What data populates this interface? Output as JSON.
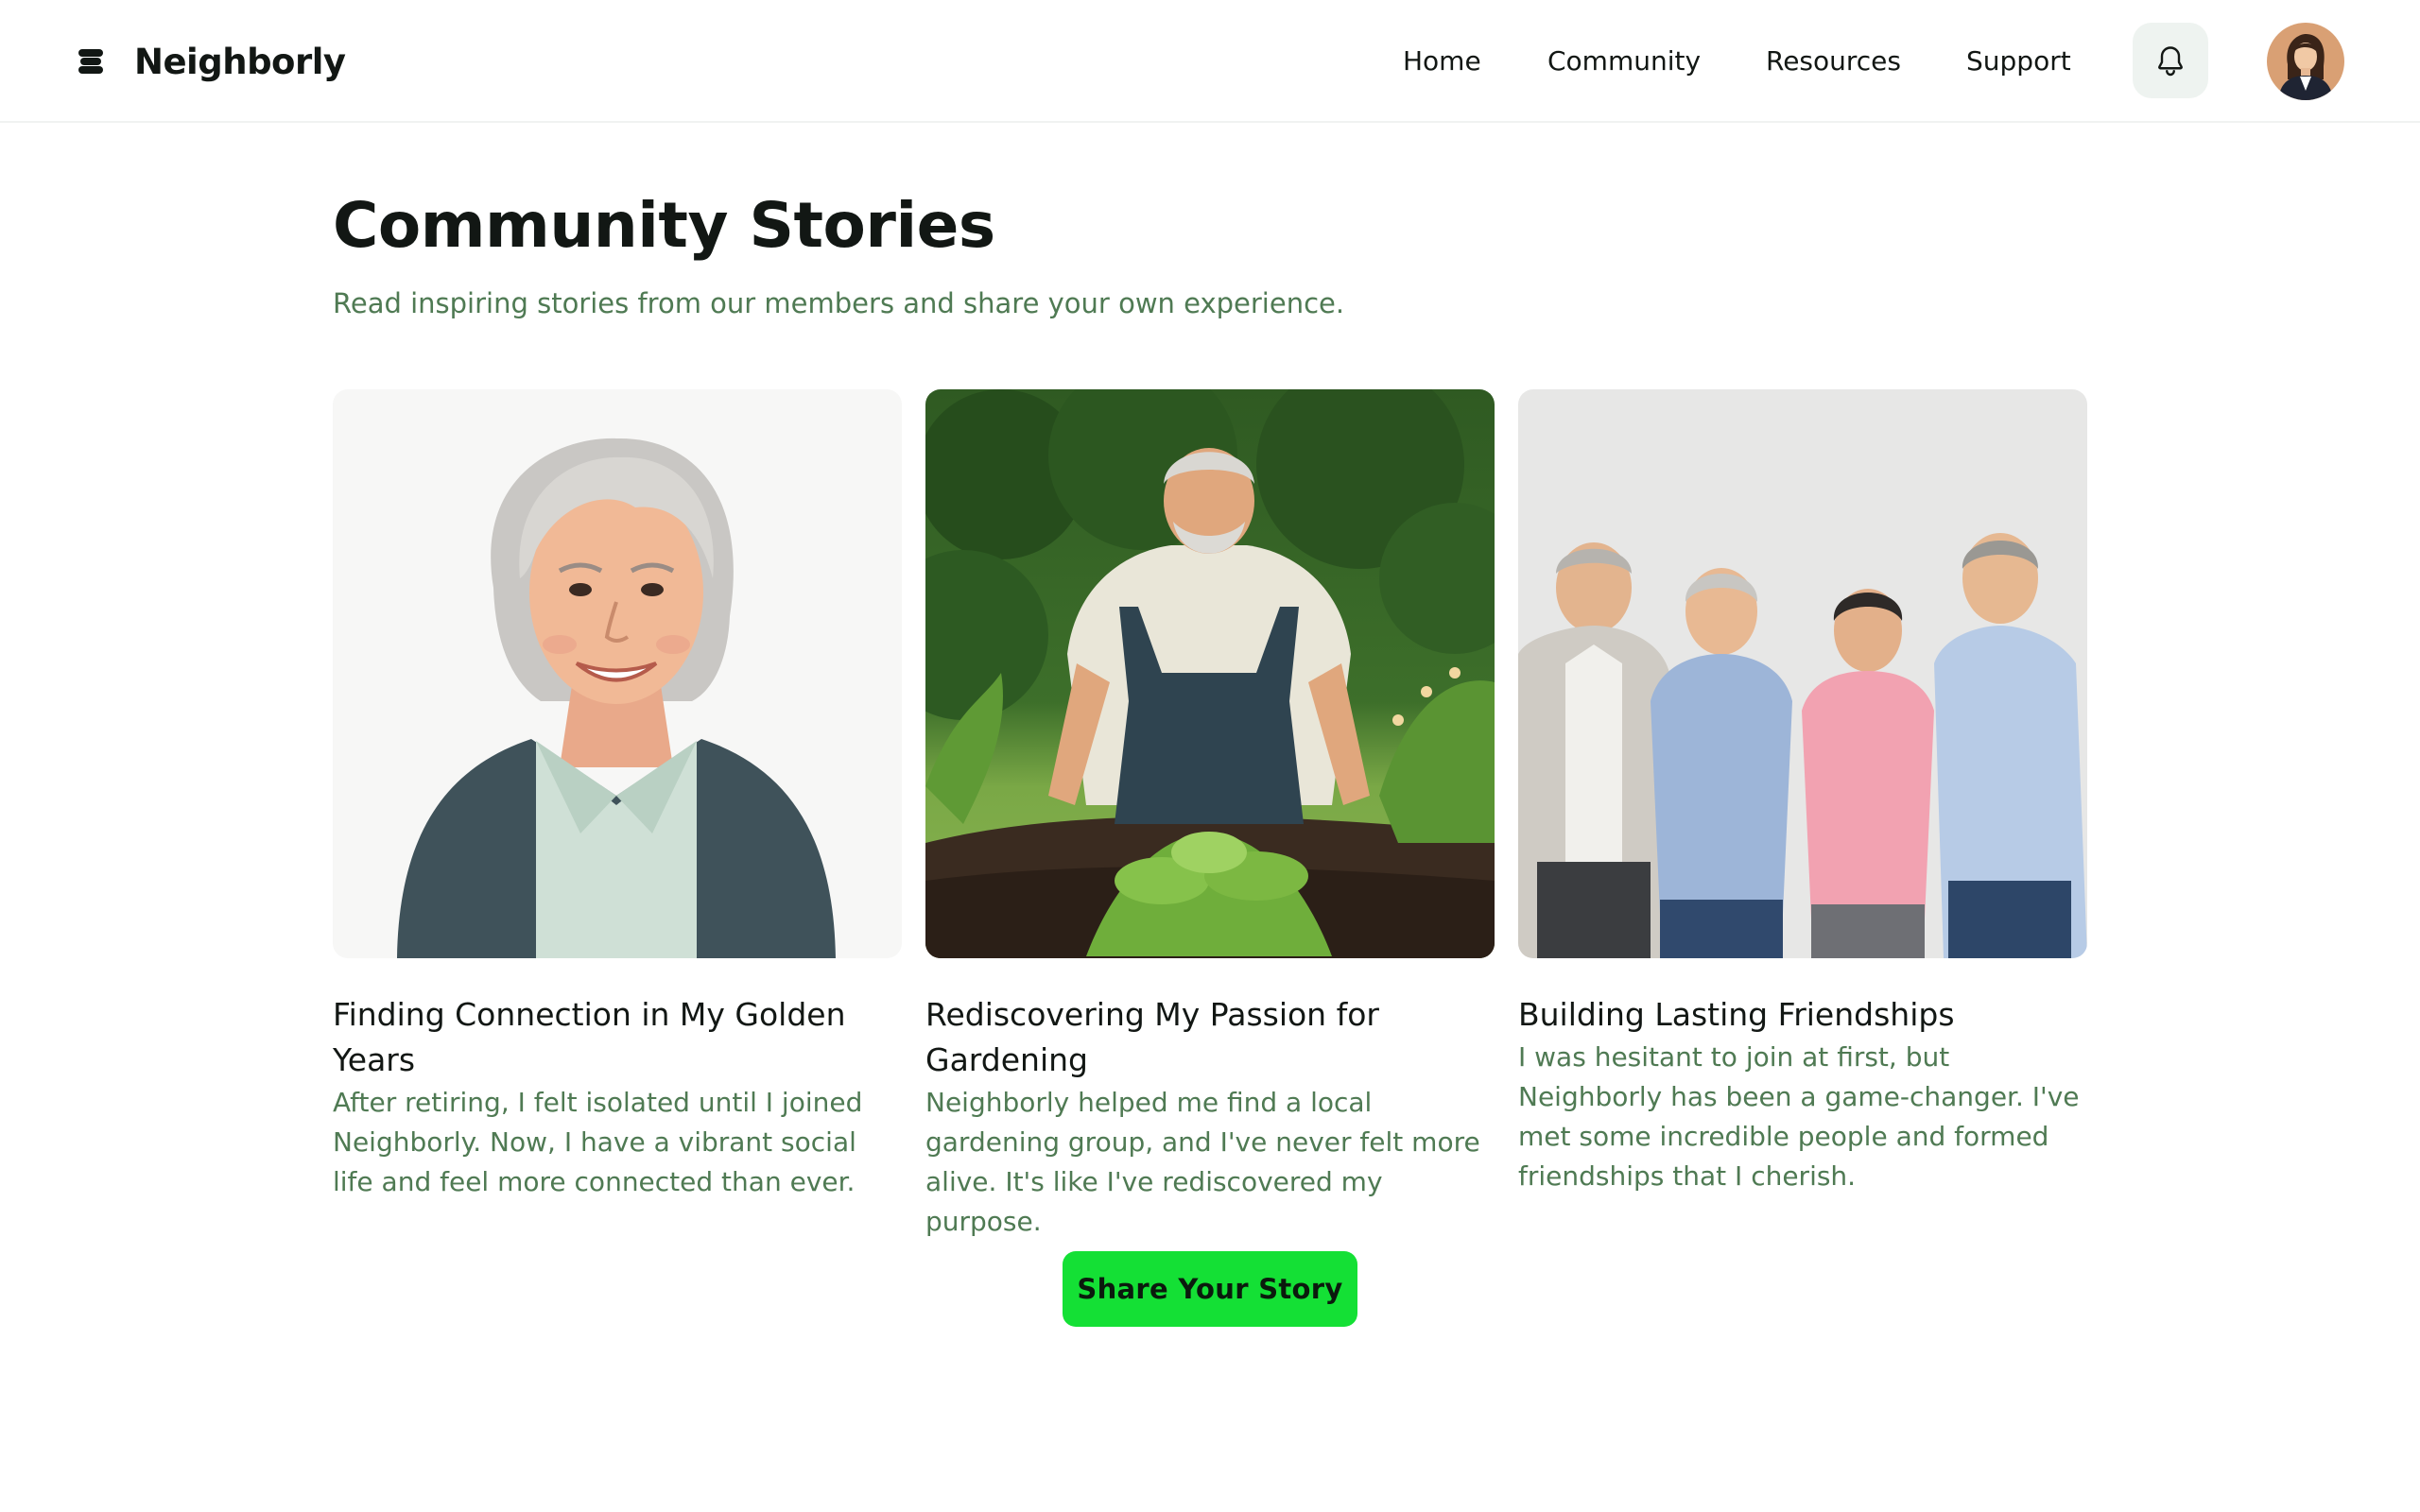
{
  "header": {
    "app_name": "Neighborly",
    "logo_icon": "stacked-layers-icon",
    "nav": [
      {
        "label": "Home"
      },
      {
        "label": "Community"
      },
      {
        "label": "Resources"
      },
      {
        "label": "Support"
      }
    ],
    "notification_icon": "bell-icon",
    "avatar_icon": "user-avatar"
  },
  "main": {
    "title": "Community Stories",
    "subtitle": "Read inspiring stories from our members and share your own experience.",
    "stories": [
      {
        "title": "Finding Connection in My Golden Years",
        "body": "After retiring, I felt isolated until I joined Neighborly. Now, I have a vibrant social life and feel more connected than ever.",
        "image_icon": "elderly-woman-portrait-image"
      },
      {
        "title": "Rediscovering My Passion for Gardening",
        "body": "Neighborly helped me find a local gardening group, and I've never felt more alive. It's like I've rediscovered my purpose.",
        "image_icon": "man-gardening-image"
      },
      {
        "title": "Building Lasting Friendships",
        "body": "I was hesitant to join at first, but Neighborly has been a game-changer. I've met some incredible people and formed friendships that I cherish.",
        "image_icon": "group-of-friends-image"
      }
    ],
    "cta_label": "Share Your Story"
  },
  "colors": {
    "accent": "#14e035",
    "muted_text": "#4f7a53",
    "primary_text": "#121714",
    "icon_button_bg": "#eef3f0"
  }
}
